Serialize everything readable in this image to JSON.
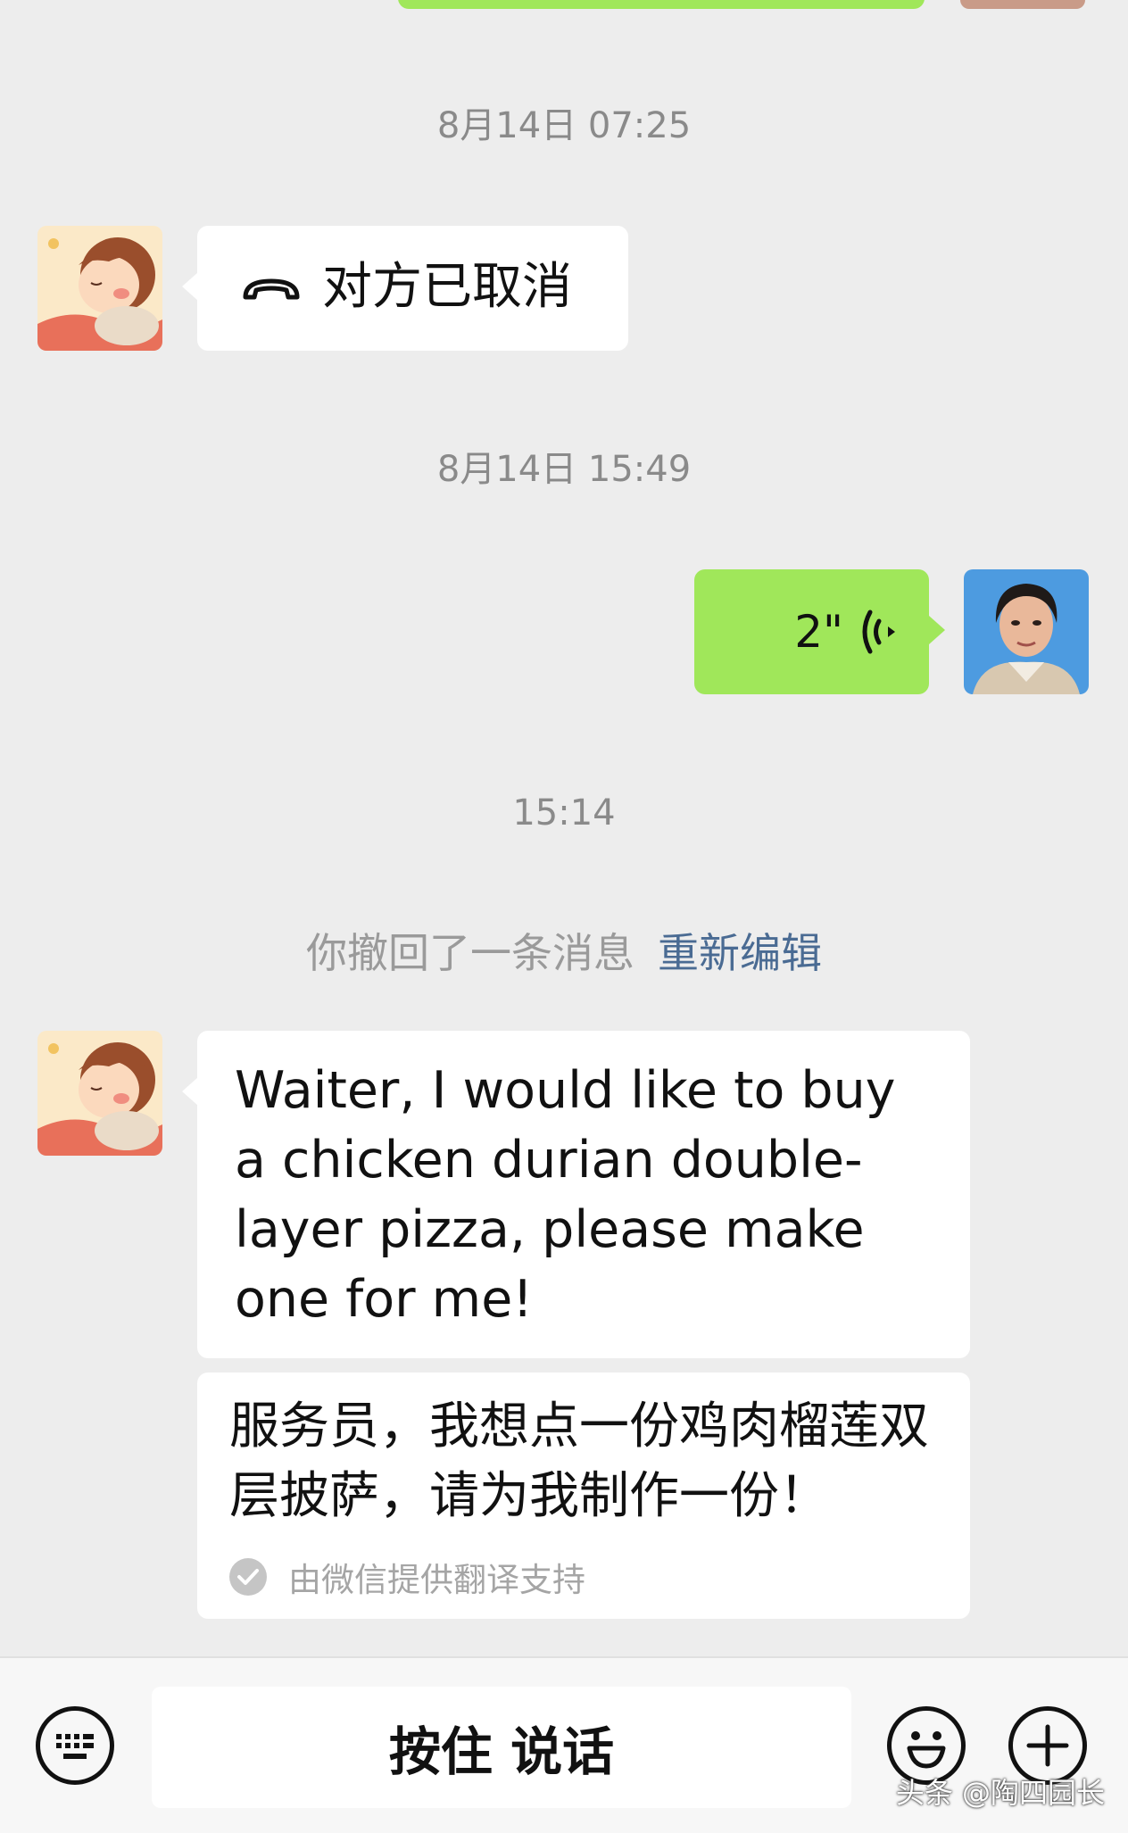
{
  "chat": {
    "timestamps": [
      "8月14日 07:25",
      "8月14日 15:49",
      "15:14"
    ],
    "call_message": {
      "text": "对方已取消",
      "icon": "phone-hangup-icon"
    },
    "voice_message": {
      "duration": "2\"",
      "icon": "voice-wave-icon"
    },
    "recall_notice": {
      "text": "你撤回了一条消息",
      "edit_label": "重新编辑"
    },
    "text_message": {
      "content": "Waiter, I would like to buy a chicken durian double-layer pizza, please make one for me!",
      "translation": "服务员，我想点一份鸡肉榴莲双层披萨，请为我制作一份！",
      "translation_note": "由微信提供翻译支持"
    }
  },
  "input_bar": {
    "keyboard_icon": "keyboard-icon",
    "hold_to_talk_label": "按住 说话",
    "emoji_icon": "emoji-icon",
    "plus_icon": "plus-icon"
  },
  "watermark": "头条 @陶四园长",
  "colors": {
    "sent_bubble": "#a0e75a",
    "received_bubble": "#ffffff",
    "link": "#4a6b93",
    "background": "#ededed"
  }
}
